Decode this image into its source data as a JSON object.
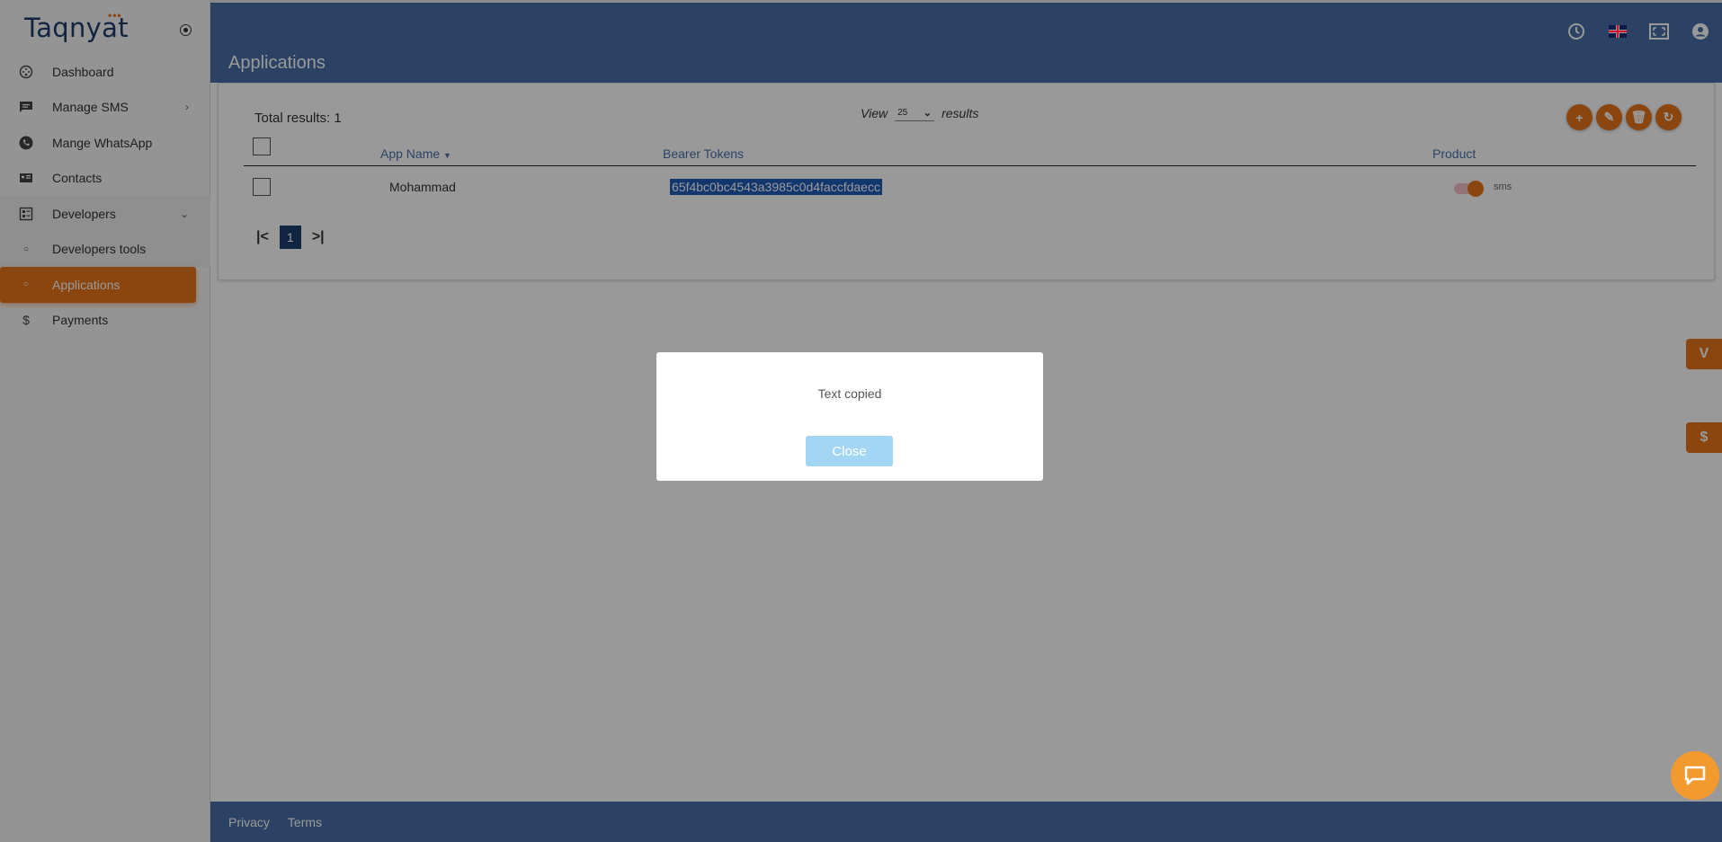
{
  "app": {
    "brand": "Taqnyat",
    "brand_dots": "•••",
    "page_title": "Applications"
  },
  "sidebar": {
    "items": [
      {
        "label": "Dashboard",
        "icon": "dashboard-icon"
      },
      {
        "label": "Manage SMS",
        "icon": "message-icon"
      },
      {
        "label": "Mange WhatsApp",
        "icon": "whatsapp-icon"
      },
      {
        "label": "Contacts",
        "icon": "contacts-icon"
      },
      {
        "label": "Developers",
        "icon": "developers-icon"
      },
      {
        "label": "Developers tools",
        "icon": "circle-icon"
      },
      {
        "label": "Applications",
        "icon": "circle-icon"
      },
      {
        "label": "Payments",
        "icon": "dollar-icon"
      }
    ]
  },
  "header": {
    "icons": [
      "clock-icon",
      "uk-flag-icon",
      "fullscreen-icon",
      "user-account-icon"
    ]
  },
  "table": {
    "total_results": "Total results: 1",
    "view_label": "View",
    "view_value": "25",
    "results_label": "results",
    "columns": [
      "App Name",
      "Bearer Tokens",
      "Product"
    ],
    "rows": [
      {
        "app_name": "Mohammad",
        "token": "65f4bc0bc4543a3985c0d4faccfdaecc",
        "product": "sms",
        "product_enabled": true
      }
    ],
    "pagination": {
      "current_page": "1",
      "first": "|<",
      "last": ">|"
    },
    "actions": [
      "add-icon",
      "edit-icon",
      "delete-icon",
      "refresh-icon"
    ]
  },
  "footer": {
    "links": [
      "Privacy",
      "Terms"
    ]
  },
  "modal": {
    "message": "Text copied",
    "close_label": "Close"
  },
  "colors": {
    "primary": "#4a6fa8",
    "accent": "#e8761c",
    "brand_navy": "#1d3e6e",
    "modal_button": "#a3d5f5"
  }
}
